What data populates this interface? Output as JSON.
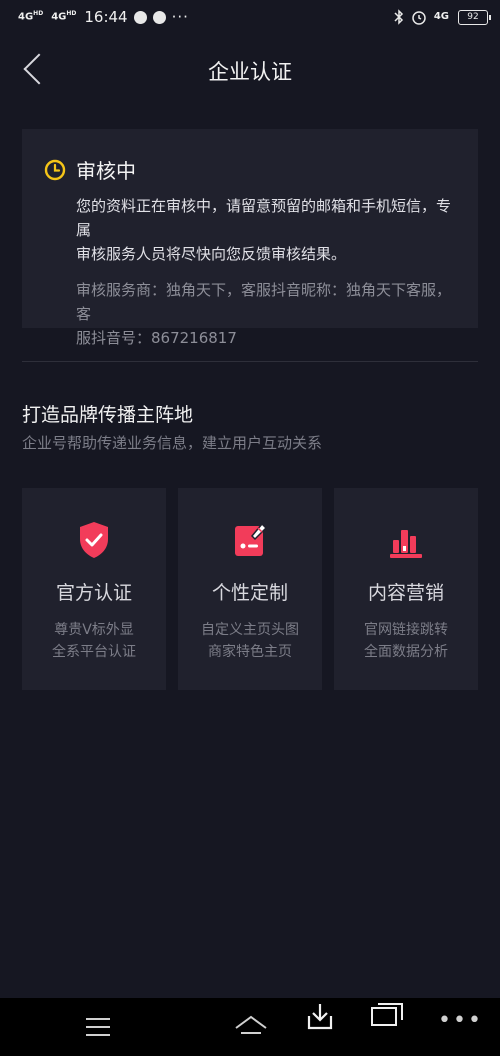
{
  "status_bar": {
    "signal_1": "4G",
    "signal_2": "4G",
    "hd": "HD",
    "time": "16:44",
    "more": "···",
    "signal_right": "4G",
    "battery": "92"
  },
  "header": {
    "title": "企业认证"
  },
  "review": {
    "status": "审核中",
    "description_line1": "您的资料正在审核中，请留意预留的邮箱和手机短信，专属",
    "description_line2": "审核服务人员将尽快向您反馈审核结果。",
    "service_line1": "审核服务商：独角天下，客服抖音昵称：独角天下客服，客",
    "service_line2": "服抖音号：867216817",
    "accent_color": "#f5c518"
  },
  "brand_section": {
    "title": "打造品牌传播主阵地",
    "subtitle": "企业号帮助传递业务信息，建立用户互动关系"
  },
  "features": [
    {
      "icon": "shield-check-icon",
      "title": "官方认证",
      "desc_line1": "尊贵V标外显",
      "desc_line2": "全系平台认证"
    },
    {
      "icon": "edit-card-icon",
      "title": "个性定制",
      "desc_line1": "自定义主页头图",
      "desc_line2": "商家特色主页"
    },
    {
      "icon": "bar-chart-icon",
      "title": "内容营销",
      "desc_line1": "官网链接跳转",
      "desc_line2": "全面数据分析"
    }
  ],
  "feature_color": "#f23c5a",
  "nav": {
    "more": "•••"
  }
}
